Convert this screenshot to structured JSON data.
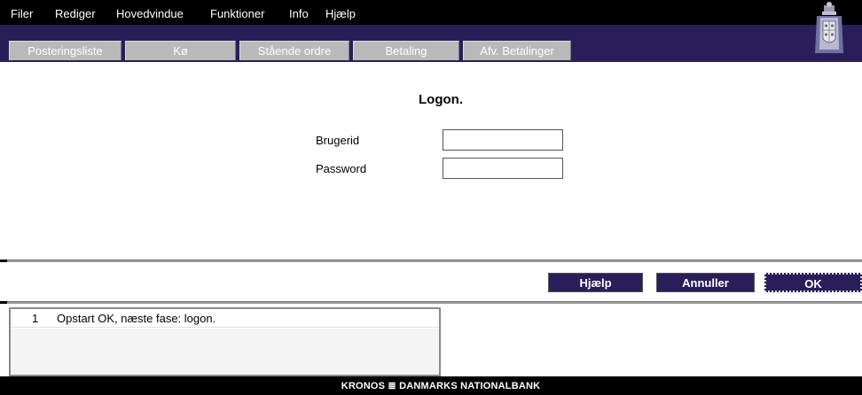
{
  "menu": {
    "items": [
      {
        "label": "Filer",
        "mnemonic": "F"
      },
      {
        "label": "Rediger",
        "mnemonic": "R"
      },
      {
        "label": "Hovedvindue"
      },
      {
        "label": "Funktioner"
      },
      {
        "label": "Info"
      },
      {
        "label": "Hjælp"
      }
    ]
  },
  "tabs": [
    {
      "label": "Posteringsliste"
    },
    {
      "label": "Kø"
    },
    {
      "label": "Stående ordre"
    },
    {
      "label": "Betaling"
    },
    {
      "label": "Afv. Betalinger"
    }
  ],
  "logon": {
    "title": "Logon.",
    "user_label": "Brugerid",
    "user_value": "",
    "password_label": "Password",
    "password_value": ""
  },
  "buttons": {
    "help": "Hjælp",
    "cancel": "Annuller",
    "ok": "OK"
  },
  "log": {
    "rows": [
      {
        "num": "1",
        "text": "Opstart OK, næste fase: logon."
      }
    ]
  },
  "footer": {
    "text": "KRONOS ≣ DANMARKS NATIONALBANK"
  },
  "colors": {
    "bar": "#2a1e5a",
    "tab_inactive": "#b9b9b9",
    "menu_bg": "#000000"
  }
}
